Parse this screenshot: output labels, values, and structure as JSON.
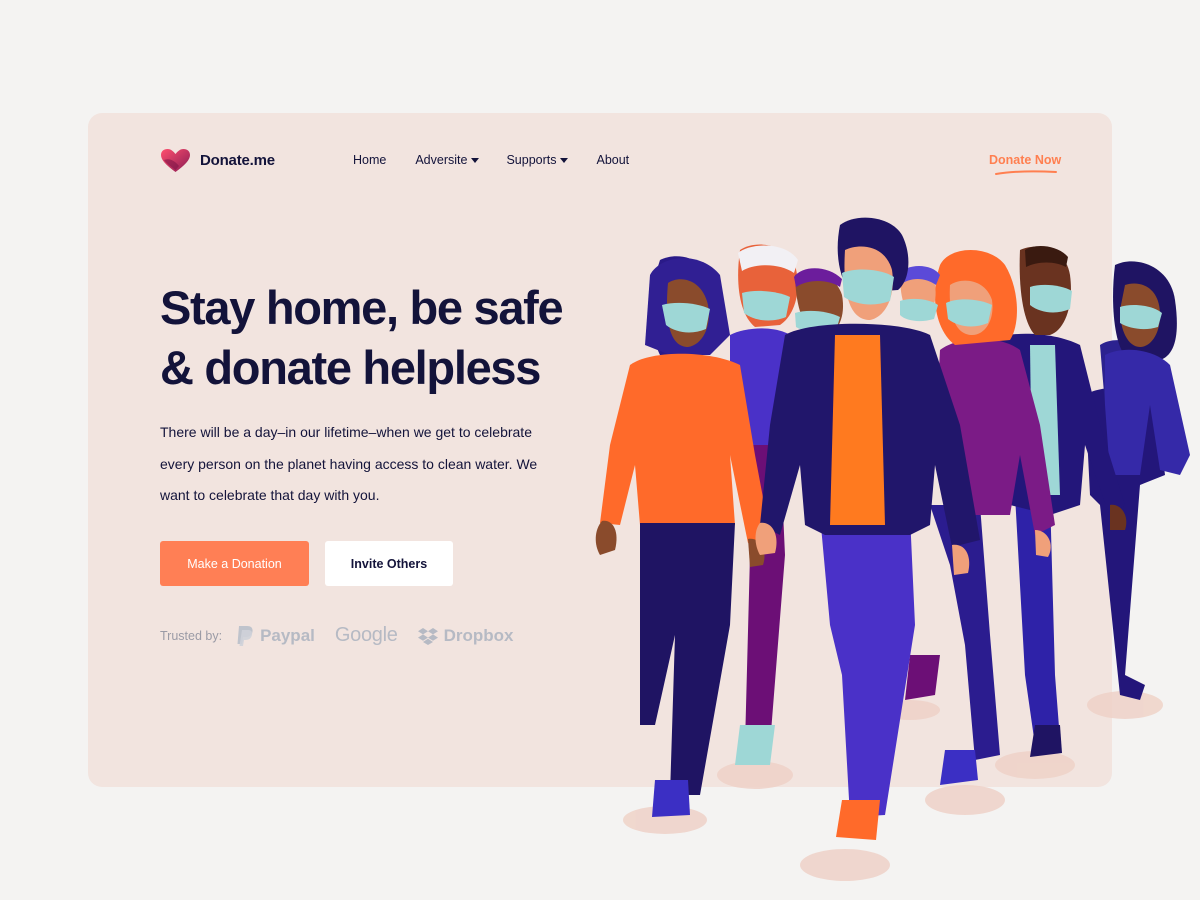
{
  "brand": {
    "name": "Donate.me",
    "logo_icon": "heart-logo-icon",
    "color": "#c4234f"
  },
  "nav": {
    "items": [
      {
        "label": "Home",
        "dropdown": false
      },
      {
        "label": "Adversite",
        "dropdown": true
      },
      {
        "label": "Supports",
        "dropdown": true
      },
      {
        "label": "About",
        "dropdown": false
      }
    ],
    "cta": "Donate Now"
  },
  "hero": {
    "headline_line1": "Stay home, be safe",
    "headline_line2": "& donate helpless",
    "description_line1": "There will be a day–in our lifetime–when we get to celebrate",
    "description_line2": "every person on the planet having access to clean water. We",
    "description_line3": "want to celebrate that day with you.",
    "primary_button": "Make a Donation",
    "secondary_button": "Invite Others"
  },
  "trusted": {
    "label": "Trusted by:",
    "brands": [
      {
        "name": "Paypal",
        "icon": "paypal-icon"
      },
      {
        "name": "Google",
        "icon": ""
      },
      {
        "name": "Dropbox",
        "icon": "dropbox-icon"
      }
    ]
  },
  "colors": {
    "accent": "#ff7f55",
    "dark_text": "#13133a",
    "card_bg": "#f2e4df",
    "page_bg": "#f4f3f2"
  },
  "illustration": {
    "icon": "masked-people-walking-illustration"
  }
}
